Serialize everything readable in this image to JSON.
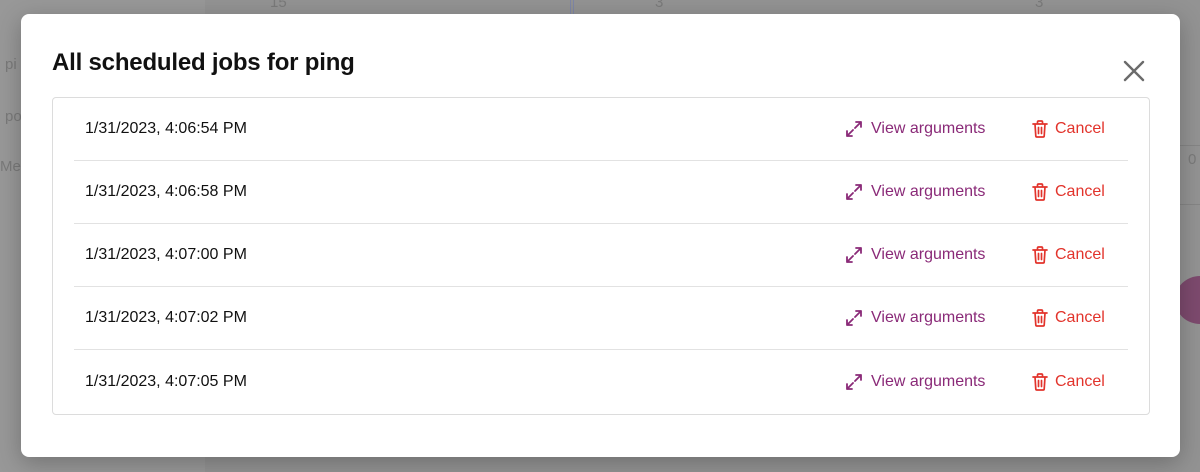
{
  "background": {
    "items": [
      "pi",
      "po",
      "Me"
    ],
    "top_numbers": [
      "15",
      "3",
      "3"
    ],
    "right_value": "0"
  },
  "modal": {
    "title": "All scheduled jobs for ping",
    "close_icon": "close-icon",
    "jobs": [
      {
        "time": "1/31/2023, 4:06:54 PM",
        "view_label": "View arguments",
        "cancel_label": "Cancel"
      },
      {
        "time": "1/31/2023, 4:06:58 PM",
        "view_label": "View arguments",
        "cancel_label": "Cancel"
      },
      {
        "time": "1/31/2023, 4:07:00 PM",
        "view_label": "View arguments",
        "cancel_label": "Cancel"
      },
      {
        "time": "1/31/2023, 4:07:02 PM",
        "view_label": "View arguments",
        "cancel_label": "Cancel"
      },
      {
        "time": "1/31/2023, 4:07:05 PM",
        "view_label": "View arguments",
        "cancel_label": "Cancel"
      }
    ],
    "colors": {
      "view_link": "#8a2a78",
      "cancel_link": "#e2332b"
    }
  }
}
